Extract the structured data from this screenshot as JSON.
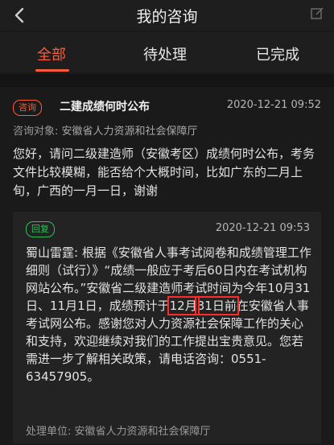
{
  "header": {
    "title": "我的咨询"
  },
  "tabs": [
    {
      "label": "全部",
      "active": true
    },
    {
      "label": "待处理",
      "active": false
    },
    {
      "label": "已完成",
      "active": false
    }
  ],
  "question": {
    "badge": "咨询",
    "title": "二建成绩何时公布",
    "time": "2020-12-21 09:52",
    "target_label": "咨询对象:",
    "target_org": "安徽省人力资源和社会保障厅",
    "body": "您好，请问二级建造师（安徽考区）成绩何时公布，考务文件比较模糊，能否给个大概时间，比如广东的二月上旬，广西的一月一日，谢谢"
  },
  "reply": {
    "badge": "回复",
    "time": "2020-12-21 09:53",
    "body_part1": "蜀山雷霆: 根据《安徽省人事考试阅卷和成绩管理工作细则（试行）》“成绩一般应于考后60日内在考试机构网站公布。”安徽省二级建造师考试时间为今年10月31日、11月1日，成绩预计于",
    "highlight_1": "12月",
    "highlight_2": "31日前",
    "body_part2": "在安徽省人事考试网公布。感谢您对人力资源社会保障工作的关心和支持，欢迎继续对我们的工作提出宝贵意见。您若需进一步了解相关政策，请电话咨询：0551-63457905。",
    "unit_label": "处理单位:",
    "unit_org": "安徽省人力资源和社会保障厅"
  },
  "colors": {
    "accent": "#ff5a3a",
    "reply_badge": "#2fbf5a",
    "highlight_box": "#ff2a2a"
  }
}
